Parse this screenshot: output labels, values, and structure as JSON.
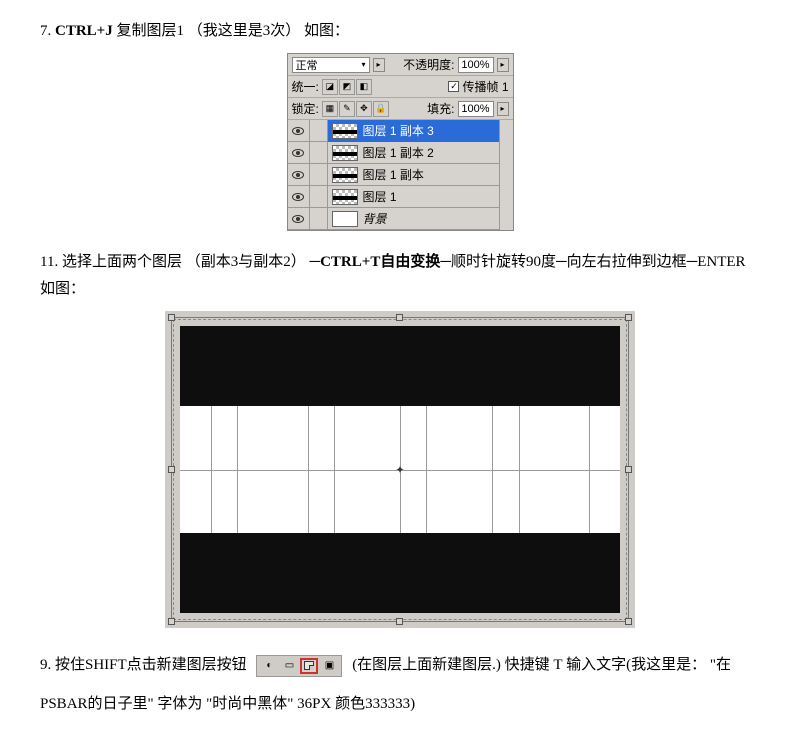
{
  "step7": {
    "num": "7.",
    "prefix": "CTRL+J",
    "text": " 复制图层1 （我这里是3次） 如图："
  },
  "layers_panel": {
    "blend_mode": "正常",
    "opacity_label": "不透明度:",
    "opacity_value": "100%",
    "unify_label": "统一:",
    "propagate_label": "传播帧 1",
    "propagate_checked": "✓",
    "lock_label": "锁定:",
    "fill_label": "填充:",
    "fill_value": "100%",
    "layers": [
      {
        "name": "图层 1 副本 3",
        "selected": true,
        "checker": true
      },
      {
        "name": "图层 1 副本 2",
        "selected": false,
        "checker": true
      },
      {
        "name": "图层 1 副本",
        "selected": false,
        "checker": true
      },
      {
        "name": "图层 1",
        "selected": false,
        "checker": true
      },
      {
        "name": "背景",
        "selected": false,
        "checker": false,
        "italic": true
      }
    ]
  },
  "step11": {
    "num": "11.",
    "part1": "选择上面两个图层 （副本3与副本2） ─",
    "bold1": "CTRL+T自由变换",
    "part2": "─顺时针旋转90度─向左右拉伸到边框─ENTER   如图："
  },
  "step9": {
    "num": "9.",
    "part1": "按住SHIFT点击新建图层按钮",
    "part2": "(在图层上面新建图层.) 快捷键 T 输入文字(我这里是：  \"在PSBAR的日子里\" 字体为 \"时尚中黑体\" 36PX 颜色333333)"
  },
  "toolbar_icons": {
    "adjust": "◐",
    "mask": "▭",
    "folder": "▣"
  }
}
